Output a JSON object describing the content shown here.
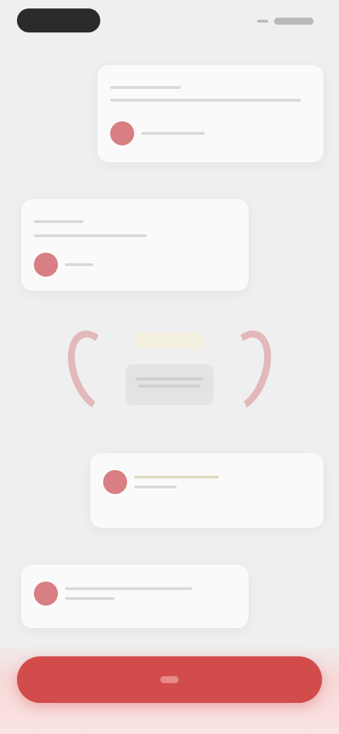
{
  "header": {
    "pill_label": "",
    "right_label": ""
  },
  "cards": [
    {
      "title": "",
      "text": "",
      "meta": ""
    },
    {
      "title": "",
      "text": "",
      "meta": ""
    },
    {
      "title": "",
      "text": "",
      "meta": ""
    },
    {
      "title": "",
      "text": "",
      "meta": ""
    }
  ],
  "illustration": {
    "box_label": ""
  },
  "primary_button": {
    "label": ""
  },
  "icons": {
    "avatar": "avatar-icon",
    "illustration": "illustration-icon"
  },
  "colors": {
    "background": "#efefef",
    "accent": "#d24c4c",
    "avatar": "#d77f82",
    "card": "#fafafa"
  }
}
